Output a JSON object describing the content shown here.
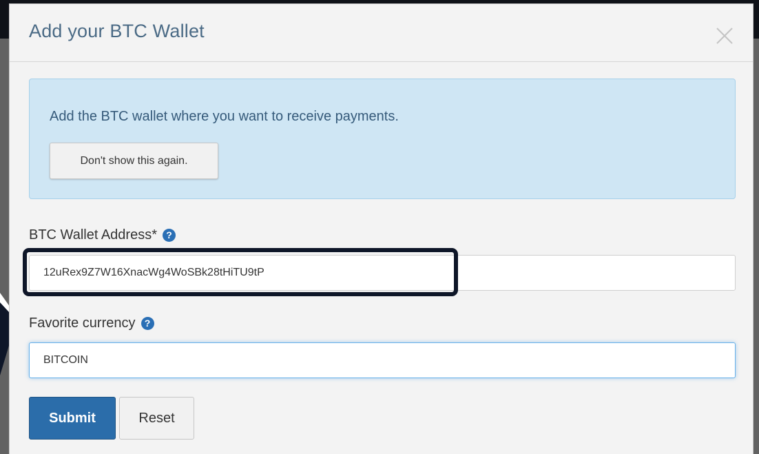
{
  "modal": {
    "title": "Add your BTC Wallet",
    "close_icon": "close-icon"
  },
  "alert": {
    "message": "Add the BTC wallet where you want to receive payments.",
    "dismiss_label": "Don't show this again."
  },
  "form": {
    "wallet_label": "BTC Wallet Address*",
    "wallet_value": "12uRex9Z7W16XnacWg4WoSBk28tHiTU9tP",
    "currency_label": "Favorite currency",
    "currency_value": "BITCOIN",
    "help_icon": "question-circle-icon",
    "help_glyph": "?"
  },
  "actions": {
    "submit_label": "Submit",
    "reset_label": "Reset"
  },
  "colors": {
    "accent": "#2b6daa",
    "alert_bg": "#cfe6f4",
    "highlight_border": "#0e1628"
  }
}
